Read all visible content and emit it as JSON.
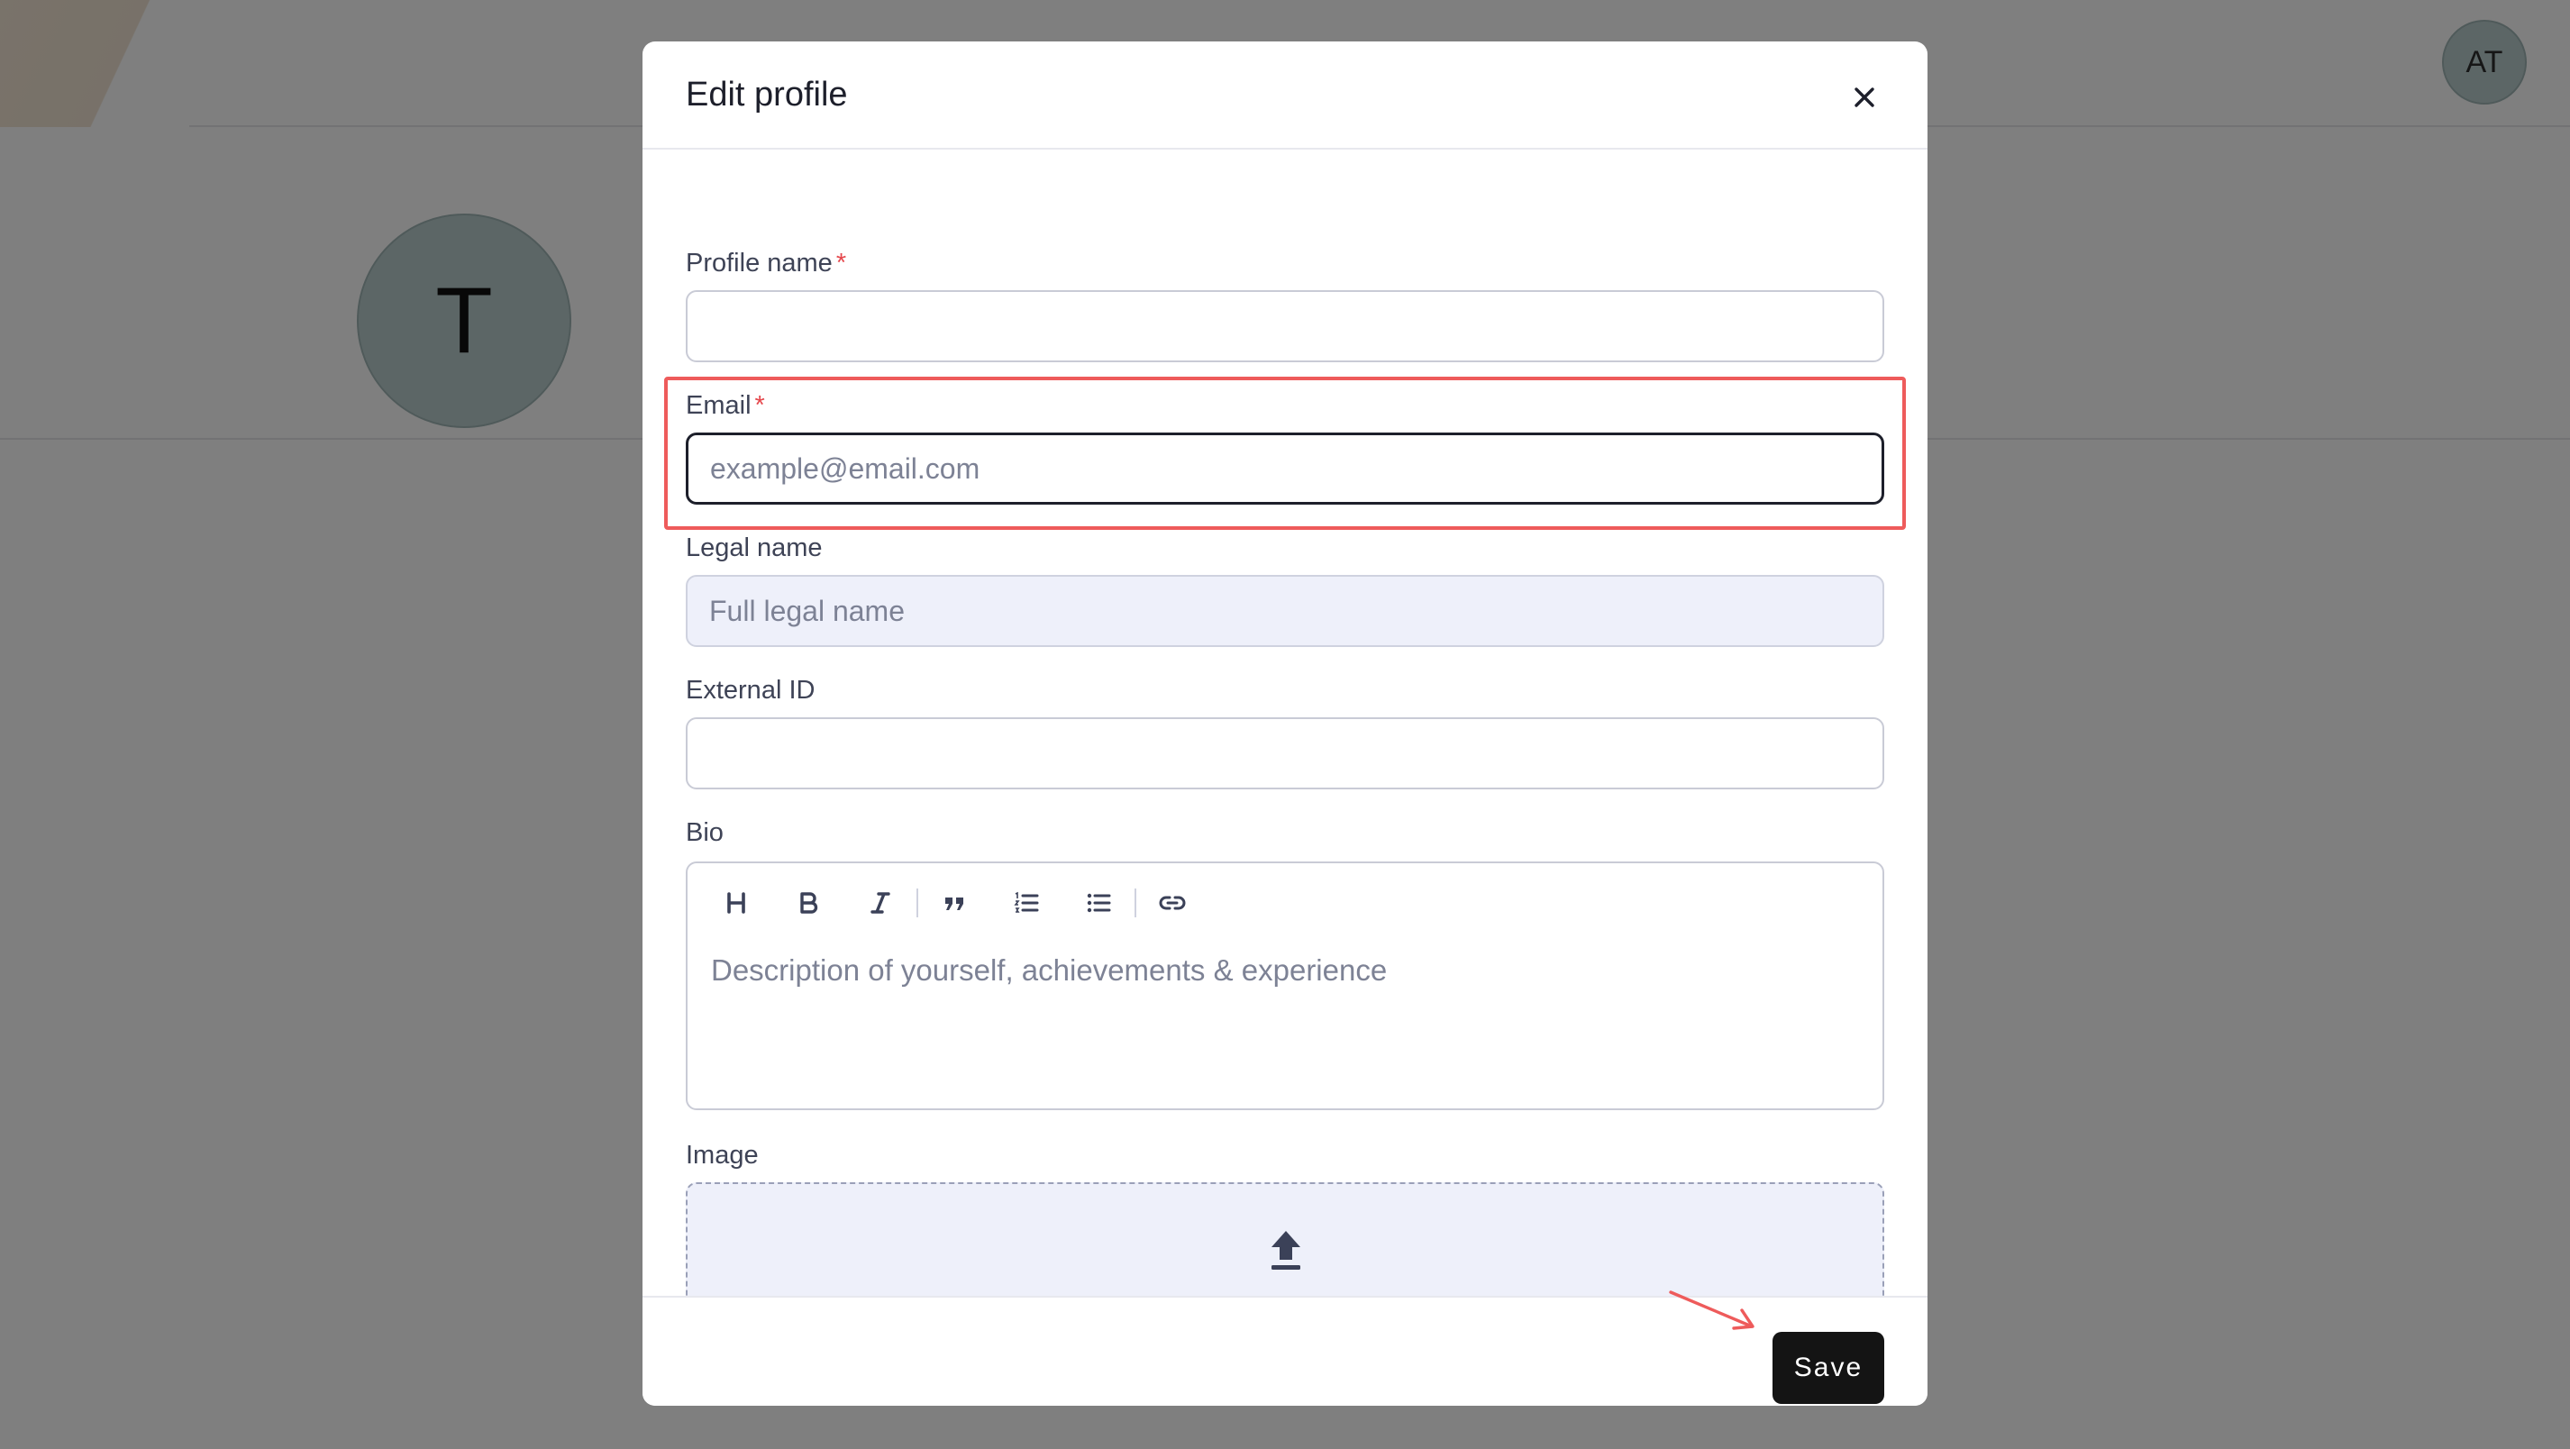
{
  "background": {
    "header_avatar_initials": "AT",
    "profile_avatar_initial": "T"
  },
  "modal": {
    "title": "Edit profile",
    "close_icon": "close-icon",
    "fields": {
      "profile_name": {
        "label": "Profile name",
        "required_mark": "*",
        "value": "",
        "placeholder": ""
      },
      "email": {
        "label": "Email",
        "required_mark": "*",
        "value": "",
        "placeholder": "example@email.com",
        "focused": true
      },
      "legal_name": {
        "label": "Legal name",
        "value": "",
        "placeholder": "Full legal name",
        "disabled": true
      },
      "external_id": {
        "label": "External ID",
        "value": "",
        "placeholder": ""
      },
      "bio": {
        "label": "Bio",
        "placeholder": "Description of yourself, achievements & experience",
        "toolbar": [
          "heading-icon",
          "bold-icon",
          "italic-icon",
          "quote-icon",
          "ordered-list-icon",
          "bullet-list-icon",
          "link-icon"
        ]
      },
      "image": {
        "label": "Image",
        "icon": "upload-icon"
      }
    },
    "footer": {
      "save_label": "Save"
    }
  },
  "annotations": {
    "highlight_color": "#ee5b5b",
    "highlighted_field": "email",
    "arrow_target": "save-button"
  },
  "colors": {
    "overlay": "rgba(0,0,0,0.5)",
    "primary_button": "#141414",
    "required": "#e5484d",
    "avatar": "#b9cdcd"
  }
}
